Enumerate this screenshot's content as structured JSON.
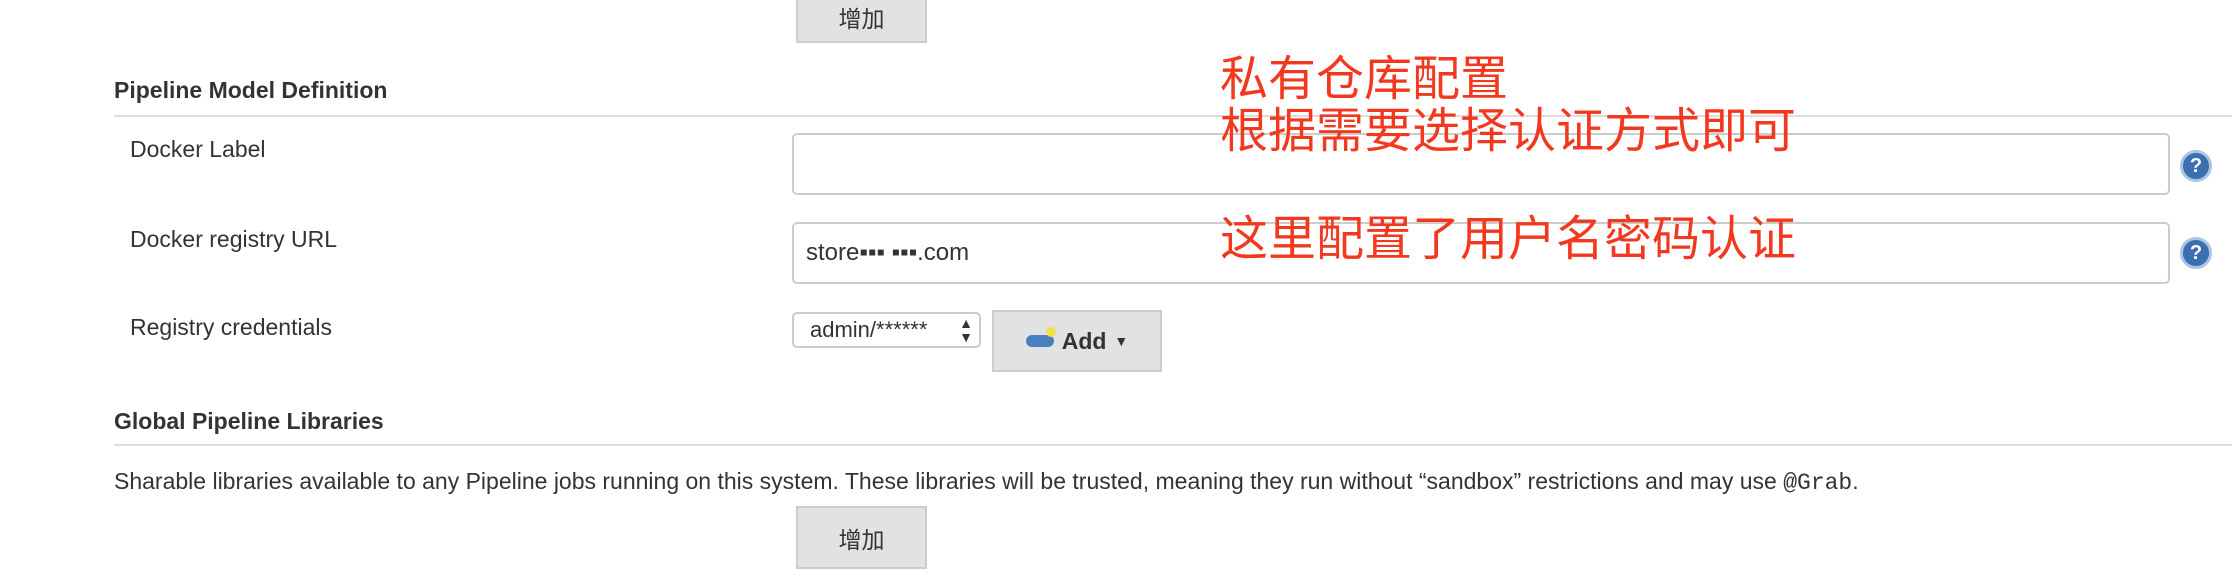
{
  "top_add_button": "增加",
  "pipeline_model": {
    "heading": "Pipeline Model Definition",
    "docker_label": {
      "label": "Docker Label",
      "value": ""
    },
    "registry_url": {
      "label": "Docker registry URL",
      "value": "store▪▪▪ ▪▪▪.com"
    },
    "credentials": {
      "label": "Registry credentials",
      "selected": "admin/******",
      "add_label": "Add"
    }
  },
  "global_libraries": {
    "heading": "Global Pipeline Libraries",
    "description": "Sharable libraries available to any Pipeline jobs running on this system. These libraries will be trusted, meaning they run without “sandbox” restrictions and may use ",
    "code": "@Grab",
    "description_end": ".",
    "add_button": "增加"
  },
  "annotations": {
    "line1": "私有仓库配置",
    "line2": "根据需要选择认证方式即可",
    "line3": "这里配置了用户名密码认证"
  },
  "help_symbol": "?"
}
